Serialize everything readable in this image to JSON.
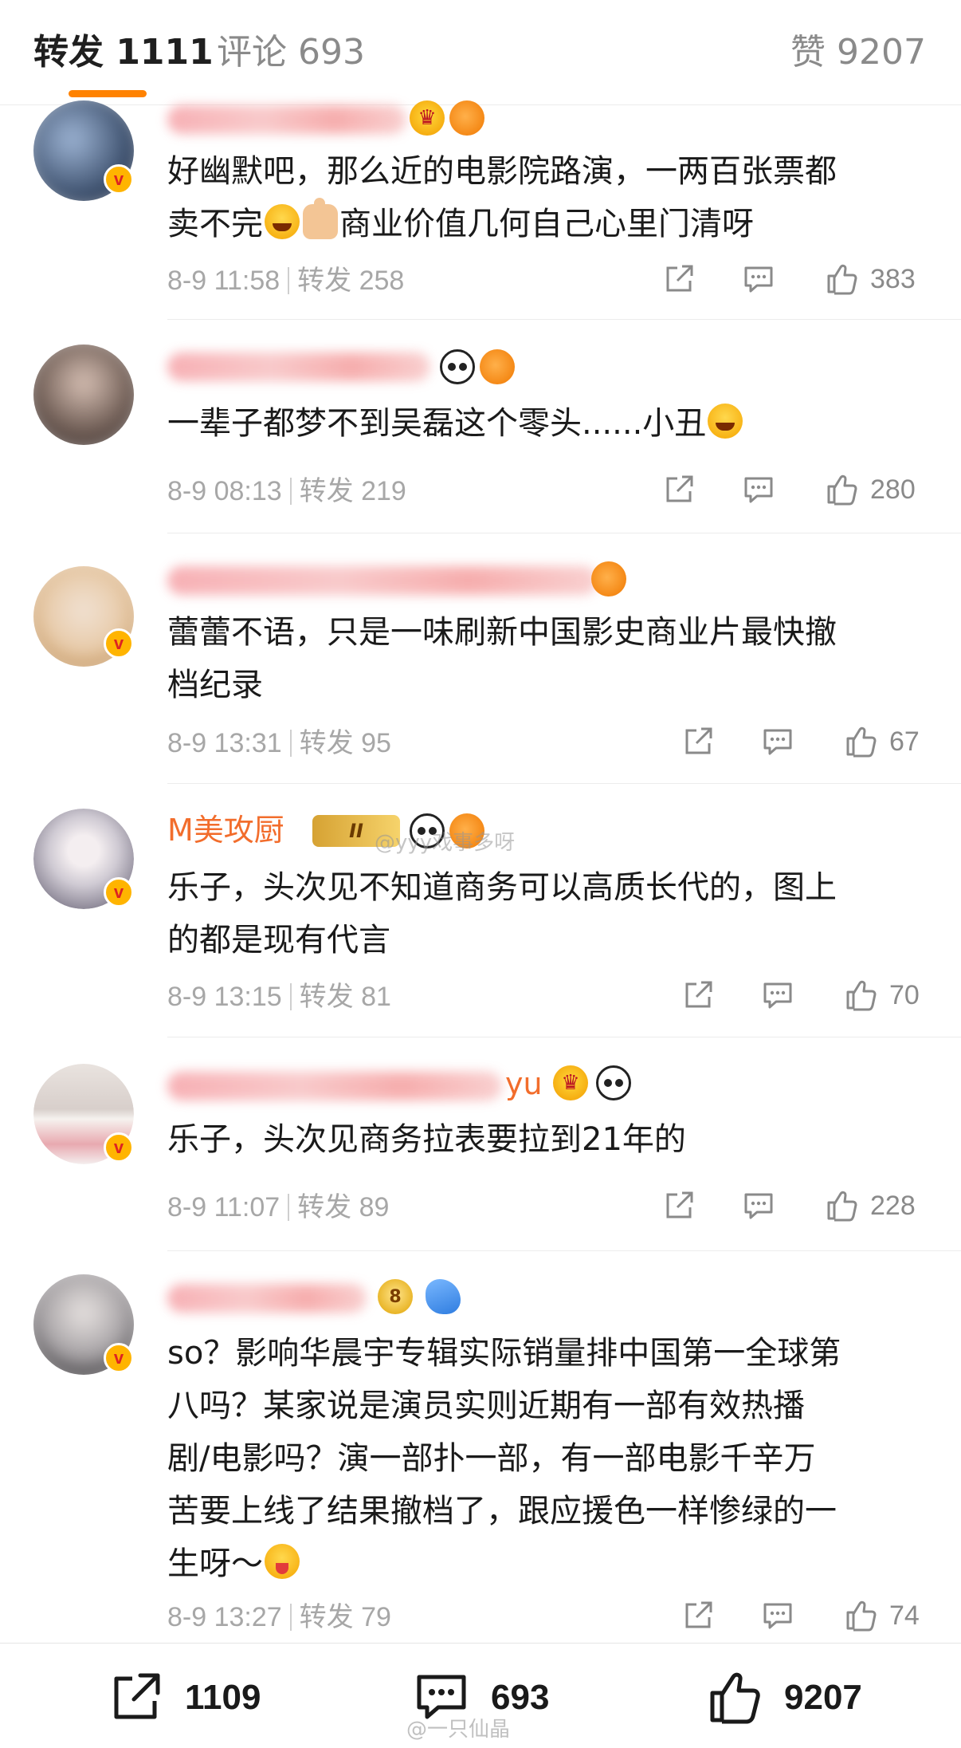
{
  "tabs": {
    "repost": "转发 1111",
    "comment": "评论 693",
    "like": "赞 9207"
  },
  "watermark": "@yyy戏事多呀",
  "watermark_bottom": "@一只仙晶",
  "comments": [
    {
      "name_blurred": true,
      "text_lines": [
        "好幽默吧，那么近的电影院路演，一两百张票都",
        "卖不完"
      ],
      "text_tail": "商业价值几何自己心里门清呀",
      "time": "8-9 11:58",
      "repost": "转发 258",
      "likes": "383"
    },
    {
      "name_blurred": true,
      "text_lines": [
        "一辈子都梦不到吴磊这个零头......小丑"
      ],
      "time": "8-9 08:13",
      "repost": "转发 219",
      "likes": "280"
    },
    {
      "name_blurred": true,
      "text_lines": [
        "蕾蕾不语，只是一味刷新中国影史商业片最快撤",
        "档纪录"
      ],
      "time": "8-9 13:31",
      "repost": "转发 95",
      "likes": "67"
    },
    {
      "name": "M美攻厨",
      "vip_label": "II",
      "text_lines": [
        "乐子，头次见不知道商务可以高质长代的，图上",
        "的都是现有代言"
      ],
      "time": "8-9 13:15",
      "repost": "转发 81",
      "likes": "70"
    },
    {
      "name_blurred": true,
      "name_suffix": "yu",
      "text_lines": [
        "乐子，头次见商务拉表要拉到21年的"
      ],
      "time": "8-9 11:07",
      "repost": "转发 89",
      "likes": "228"
    },
    {
      "name_blurred": true,
      "text_lines": [
        "so？影响华晨宇专辑实际销量排中国第一全球第",
        "八吗？某家说是演员实则近期有一部有效热播",
        "剧/电影吗？演一部扑一部，有一部电影千辛万",
        "苦要上线了结果撤档了，跟应援色一样惨绿的一",
        "生呀～"
      ],
      "time": "8-9 13:27",
      "repost": "转发 79",
      "likes": "74"
    }
  ],
  "bottom_bar": {
    "repost_count": "1109",
    "comment_count": "693",
    "like_count": "9207"
  },
  "colors": {
    "accent": "#ff8200",
    "username": "#f26d2c",
    "meta": "#a7a7a7",
    "text": "#1a1a1a"
  }
}
